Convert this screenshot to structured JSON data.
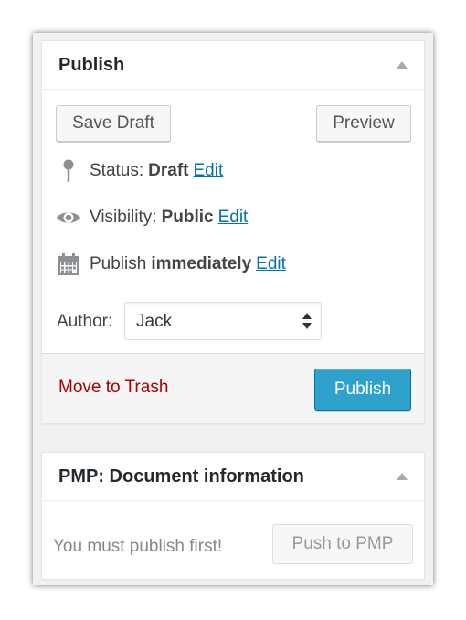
{
  "publish_box": {
    "title": "Publish",
    "save_draft_label": "Save Draft",
    "preview_label": "Preview",
    "status_label": "Status:",
    "status_value": "Draft",
    "status_edit": "Edit",
    "visibility_label": "Visibility:",
    "visibility_value": "Public",
    "visibility_edit": "Edit",
    "schedule_label": "Publish",
    "schedule_value": "immediately",
    "schedule_edit": "Edit",
    "author_label": "Author:",
    "author_value": "Jack",
    "trash_label": "Move to Trash",
    "publish_button": "Publish"
  },
  "pmp_box": {
    "title": "PMP: Document information",
    "message": "You must publish first!",
    "push_button": "Push to PMP"
  },
  "colors": {
    "primary_button": "#2ea2cc",
    "link": "#0073aa",
    "trash": "#a00000"
  },
  "icons": [
    "pin-icon",
    "eye-icon",
    "calendar-icon",
    "collapse-arrow-icon",
    "select-arrows-icon"
  ]
}
